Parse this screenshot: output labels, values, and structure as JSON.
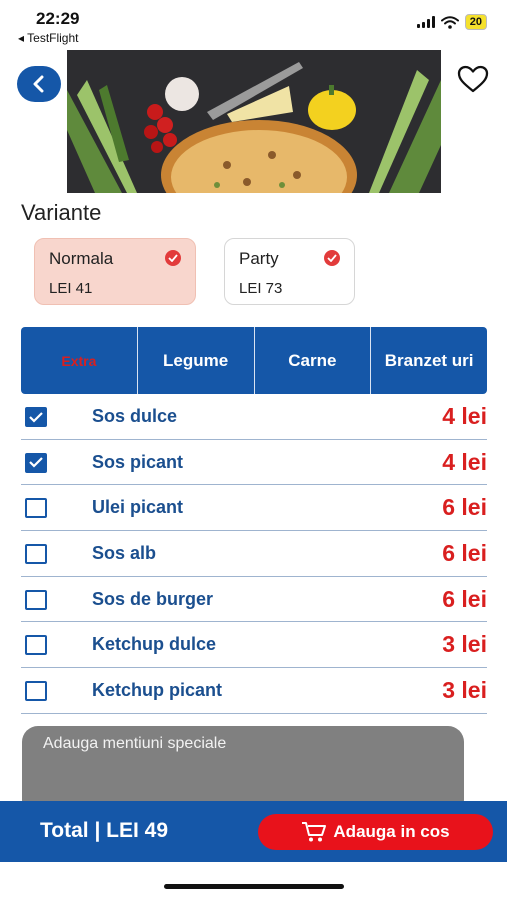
{
  "status_bar": {
    "time": "22:29",
    "back_app": "◂ TestFlight",
    "battery": "20"
  },
  "header": {
    "back_icon": "chevron-left-icon",
    "favorite_icon": "heart-icon"
  },
  "variants": {
    "title": "Variante",
    "items": [
      {
        "name": "Normala",
        "price": "LEI 41",
        "selected": true
      },
      {
        "name": "Party",
        "price": "LEI 73",
        "selected": false
      }
    ]
  },
  "tabs": [
    {
      "label": "Extra",
      "active": true
    },
    {
      "label": "Legume",
      "active": false
    },
    {
      "label": "Carne",
      "active": false
    },
    {
      "label": "Branzet uri",
      "active": false
    }
  ],
  "options": [
    {
      "name": "Sos dulce",
      "price": "4 lei",
      "checked": true
    },
    {
      "name": "Sos picant",
      "price": "4 lei",
      "checked": true
    },
    {
      "name": "Ulei picant",
      "price": "6 lei",
      "checked": false
    },
    {
      "name": "Sos alb",
      "price": "6 lei",
      "checked": false
    },
    {
      "name": "Sos de burger",
      "price": "6 lei",
      "checked": false
    },
    {
      "name": "Ketchup dulce",
      "price": "3 lei",
      "checked": false
    },
    {
      "name": "Ketchup picant",
      "price": "3 lei",
      "checked": false
    }
  ],
  "notes": {
    "placeholder": "Adauga mentiuni speciale"
  },
  "footer": {
    "total": "Total | LEI  49",
    "cart_label": "Adauga in cos"
  },
  "colors": {
    "primary_blue": "#1557a8",
    "price_red": "#d91f1f",
    "cart_red": "#e8121b",
    "selected_variant": "#f8d6cd"
  }
}
